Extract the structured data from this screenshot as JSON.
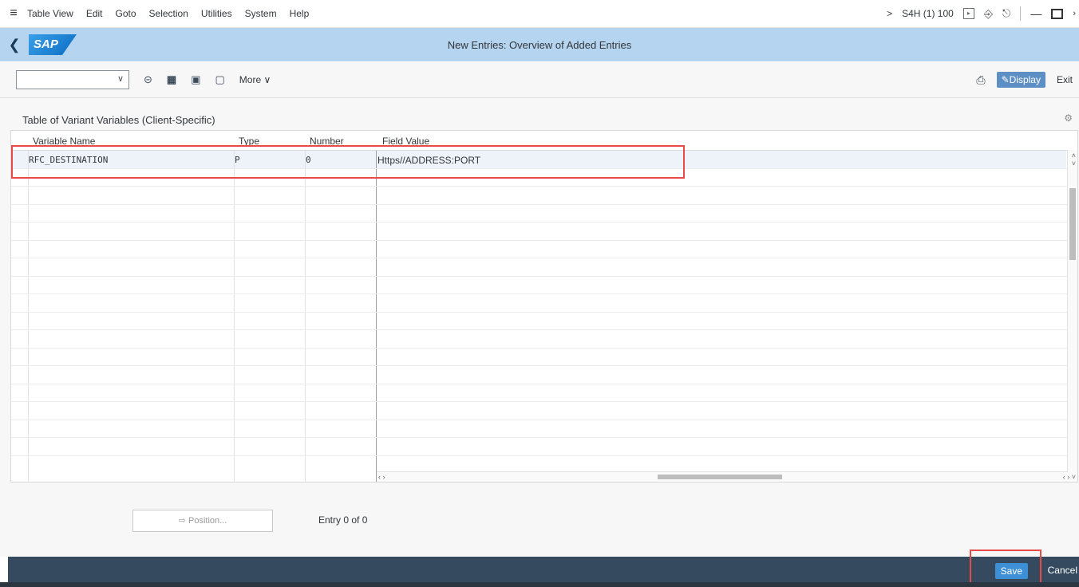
{
  "menubar": {
    "items": [
      "Table View",
      "Edit",
      "Goto",
      "Selection",
      "Utilities",
      "System",
      "Help"
    ],
    "system_info": "S4H (1) 100",
    "chevron": ">"
  },
  "titlebar": {
    "logo_text": "SAP",
    "title": "New Entries: Overview of Added Entries"
  },
  "toolbar": {
    "more_label": "More",
    "display_label": "Display",
    "exit_label": "Exit"
  },
  "table": {
    "title": "Table of Variant Variables (Client-Specific)",
    "columns": [
      "Variable Name",
      "Type",
      "Number",
      "Field Value"
    ],
    "rows": [
      {
        "variable_name": "RFC_DESTINATION",
        "type": "P",
        "number": "0",
        "field_value": "Https//ADDRESS:PORT"
      }
    ]
  },
  "footerbar": {
    "position_label": "Position...",
    "entry_text": "Entry 0 of 0"
  },
  "actions": {
    "save_label": "Save",
    "cancel_label": "Cancel"
  },
  "colors": {
    "titlebar_bg": "#b5d4f0",
    "footer_bg": "#354a5f",
    "save_bg": "#3d8fd6",
    "highlight": "#e84a4a"
  }
}
